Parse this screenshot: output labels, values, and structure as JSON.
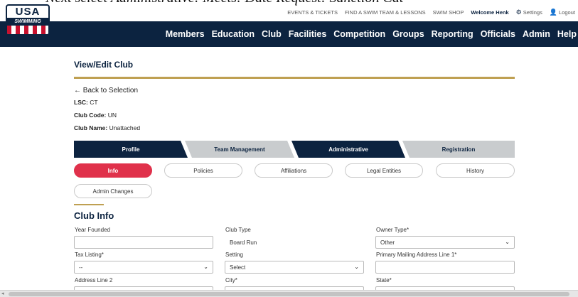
{
  "caption": "Next select Administrative: Meets: Date Request: Sanction Cat",
  "utility_nav": {
    "events_tickets": "EVENTS & TICKETS",
    "find_team": "FIND A SWIM TEAM & LESSONS",
    "swim_shop": "SWIM SHOP",
    "welcome": "Welcome Henk",
    "settings": "Settings",
    "logout": "Logout"
  },
  "logo": {
    "top": "USA",
    "band": "SWIMMING"
  },
  "main_nav": [
    "Members",
    "Education",
    "Club",
    "Facilities",
    "Competition",
    "Groups",
    "Reporting",
    "Officials",
    "Admin",
    "Help"
  ],
  "page_title": "View/Edit Club",
  "back_link": "← Back to Selection",
  "club": {
    "lsc_label": "LSC:",
    "lsc_value": "CT",
    "code_label": "Club Code:",
    "code_value": "UN",
    "name_label": "Club Name:",
    "name_value": "Unattached"
  },
  "tabs": [
    "Profile",
    "Team Management",
    "Administrative",
    "Registration"
  ],
  "subtabs": [
    "Info",
    "Policies",
    "Affiliations",
    "Legal Entities",
    "History",
    "Admin Changes"
  ],
  "section_title": "Club Info",
  "form": {
    "year_founded_label": "Year Founded",
    "year_founded_value": "",
    "club_type_label": "Club Type",
    "club_type_value": "Board Run",
    "owner_type_label": "Owner Type*",
    "owner_type_value": "Other",
    "tax_listing_label": "Tax Listing*",
    "tax_listing_value": "--",
    "setting_label": "Setting",
    "setting_value": "Select",
    "mailing_line1_label": "Primary Mailing Address Line 1*",
    "mailing_line1_value": "",
    "address_line2_label": "Address Line 2",
    "city_label": "City*",
    "state_label": "State*"
  },
  "colors": {
    "navy": "#0c2340",
    "gold": "#bfa052",
    "active_pill": "#e0314b",
    "inactive_tab": "#c9ccce"
  }
}
